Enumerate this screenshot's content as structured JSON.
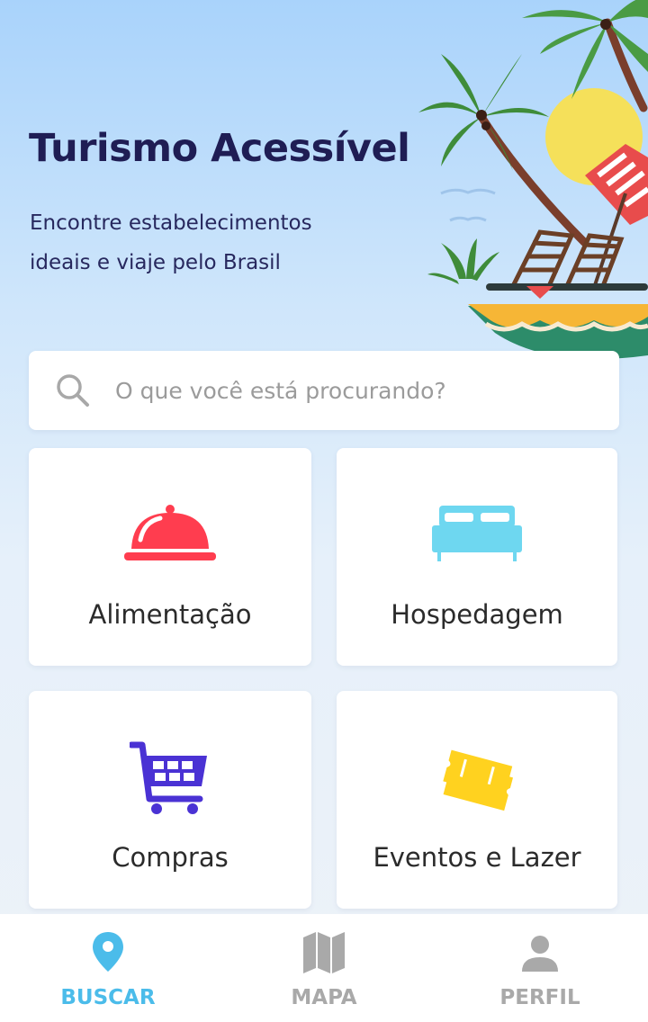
{
  "hero": {
    "title": "Turismo Acessível",
    "subtitle_line1": "Encontre estabelecimentos",
    "subtitle_line2": "ideais e viaje pelo Brasil"
  },
  "search": {
    "placeholder": "O que você está procurando?",
    "icon": "search-icon"
  },
  "categories": [
    {
      "label": "Alimentação",
      "icon": "cloche-icon",
      "color": "#ff3d4f"
    },
    {
      "label": "Hospedagem",
      "icon": "bed-icon",
      "color": "#6ed7f0"
    },
    {
      "label": "Compras",
      "icon": "shopping-cart-icon",
      "color": "#4a32d4"
    },
    {
      "label": "Eventos e Lazer",
      "icon": "tickets-icon",
      "color": "#ffd21f"
    }
  ],
  "bottom_nav": [
    {
      "label": "BUSCAR",
      "icon": "location-pin-icon",
      "active": true,
      "color": "#4bbcea"
    },
    {
      "label": "MAPA",
      "icon": "map-icon",
      "active": false,
      "color": "#a9a9a9"
    },
    {
      "label": "PERFIL",
      "icon": "person-icon",
      "active": false,
      "color": "#a9a9a9"
    }
  ]
}
